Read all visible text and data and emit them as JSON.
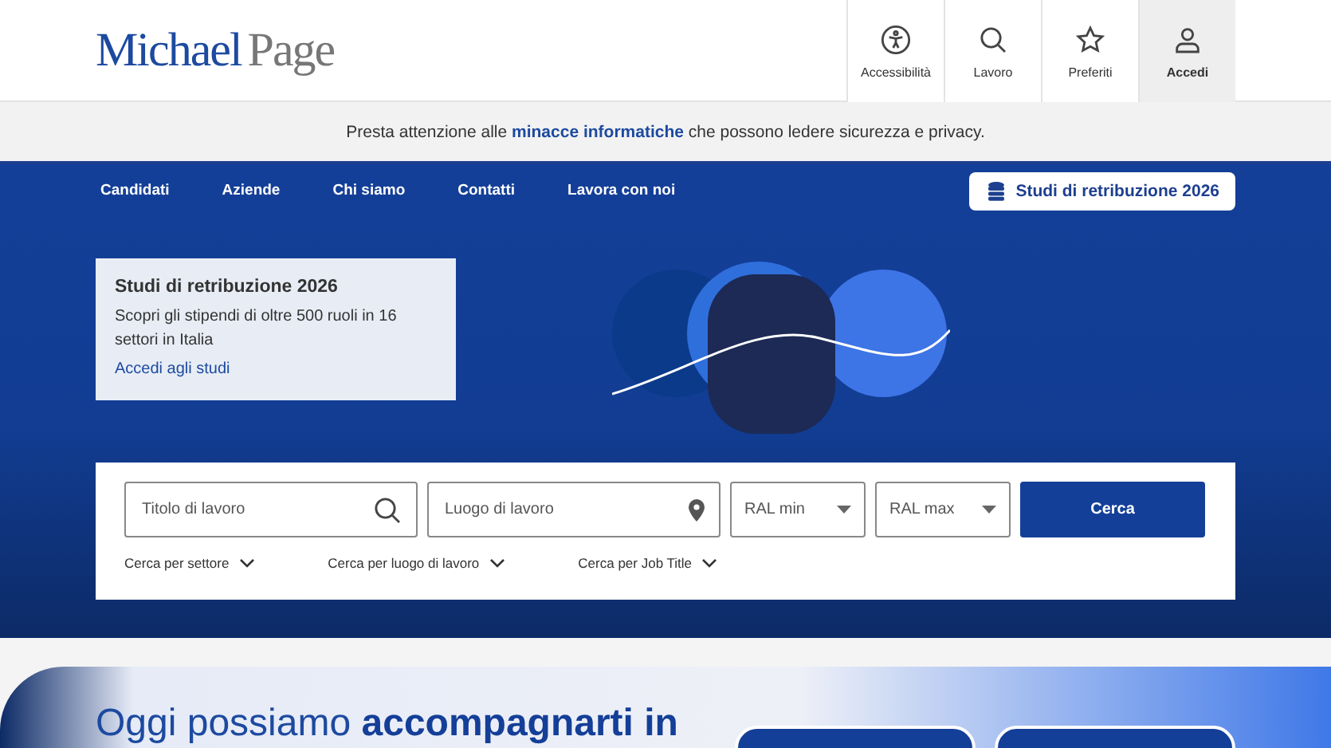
{
  "logo": {
    "first": "Michael",
    "second": "Page"
  },
  "header_actions": [
    {
      "kind": "accessibility",
      "label": "Accessibilità",
      "selected": false
    },
    {
      "kind": "search",
      "label": "Lavoro",
      "selected": false
    },
    {
      "kind": "star",
      "label": "Preferiti",
      "selected": false
    },
    {
      "kind": "user",
      "label": "Accedi",
      "selected": true
    }
  ],
  "notice": {
    "before": "Presta attenzione alle",
    "link": "minacce informatiche",
    "after": "che possono ledere sicurezza e privacy."
  },
  "nav": {
    "items": [
      "Candidati",
      "Aziende",
      "Chi siamo",
      "Contatti",
      "Lavora con noi"
    ],
    "cta": "Studi di retribuzione 2026"
  },
  "promo_card": {
    "title": "Studi di retribuzione 2026",
    "text": "Scopri gli stipendi di oltre 500 ruoli in 16 settori in Italia",
    "link": "Accedi agli studi"
  },
  "search": {
    "job_title": {
      "placeholder": "Titolo di lavoro"
    },
    "location": {
      "placeholder": "Luogo di lavoro"
    },
    "ral_min": "RAL min",
    "ral_max": "RAL max",
    "button": "Cerca",
    "filters": [
      "Cerca per settore",
      "Cerca per luogo di lavoro",
      "Cerca per Job Title"
    ]
  },
  "bottom": {
    "headline": "Oggi possiamo **accompagnarti in**"
  }
}
